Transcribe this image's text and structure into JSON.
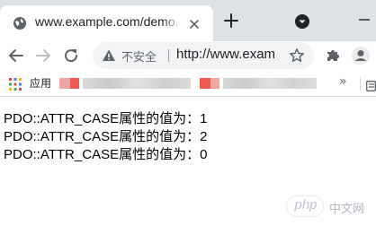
{
  "browser": {
    "tab": {
      "title": "www.example.com/demo.php",
      "favicon": "globe-icon",
      "close_icon": "close-icon"
    },
    "new_tab_icon": "plus-icon",
    "tab_search_icon": "chevron-down-circle-icon",
    "toolbar": {
      "back_icon": "back-arrow-icon",
      "forward_icon": "forward-arrow-icon",
      "reload_icon": "reload-icon",
      "security_icon": "warning-triangle-icon",
      "security_label": "不安全",
      "url": "http://www.example.com/demo.php",
      "bookmark_star_icon": "star-icon",
      "extensions_icon": "puzzle-icon",
      "profile_icon": "avatar-icon"
    },
    "bookmarks_bar": {
      "apps_icon": "apps-grid-icon",
      "apps_label": "应用",
      "overflow_label": "»",
      "reading_list_icon": "reading-list-icon"
    }
  },
  "page": {
    "lines": [
      "PDO::ATTR_CASE属性的值为：1",
      "PDO::ATTR_CASE属性的值为：2",
      "PDO::ATTR_CASE属性的值为：0"
    ]
  },
  "watermark": {
    "logo_text": "php",
    "text": "中文网"
  },
  "colors": {
    "tab_strip": "#dee1e6",
    "omnibox": "#f1f3f4",
    "text": "#202124",
    "icon": "#5f6368"
  }
}
